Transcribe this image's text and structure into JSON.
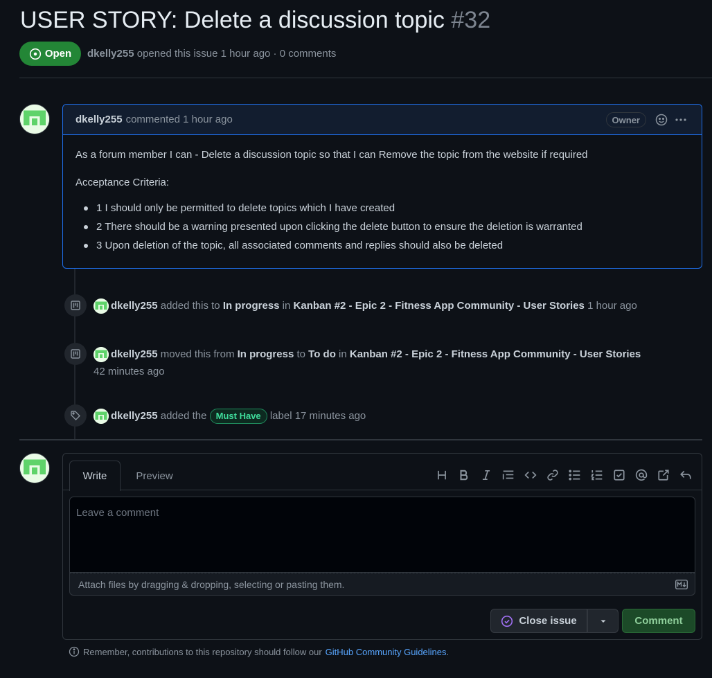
{
  "issue": {
    "title": "USER STORY: Delete a discussion topic",
    "number": "#32",
    "state": "Open",
    "author": "dkelly255",
    "meta_rest": "opened this issue 1 hour ago · 0 comments"
  },
  "comment": {
    "author": "dkelly255",
    "action": "commented 1 hour ago",
    "badge": "Owner",
    "paragraph": "As a forum member I can - Delete a discussion topic so that I can Remove the topic from the website if required",
    "criteria_heading": "Acceptance Criteria:",
    "criteria": [
      "1 I should only be permitted to delete topics which I have created",
      "2 There should be a warning presented upon clicking the delete button to ensure the deletion is warranted",
      "3 Upon deletion of the topic, all associated comments and replies should also be deleted"
    ]
  },
  "timeline": [
    {
      "icon": "project-icon",
      "actor": "dkelly255",
      "text1": "added this to",
      "column": "In progress",
      "text2": "in",
      "project": "Kanban #2 - Epic 2 - Fitness App Community - User Stories",
      "time": "1 hour ago"
    },
    {
      "icon": "project-icon",
      "actor": "dkelly255",
      "text1": "moved this from",
      "from_column": "In progress",
      "text_to": "to",
      "to_column": "To do",
      "text2": "in",
      "project": "Kanban #2 - Epic 2 - Fitness App Community - User Stories",
      "time": "42 minutes ago"
    },
    {
      "icon": "tag-icon",
      "actor": "dkelly255",
      "text1": "added the",
      "label": "Must Have",
      "text2": "label 17 minutes ago"
    }
  ],
  "editor": {
    "tab_write": "Write",
    "tab_preview": "Preview",
    "placeholder": "Leave a comment",
    "attach_text": "Attach files by dragging & dropping, selecting or pasting them.",
    "close_issue": "Close issue",
    "comment_button": "Comment",
    "toolbar_icons": [
      "heading-icon",
      "bold-icon",
      "italic-icon",
      "quote-icon",
      "code-icon",
      "link-icon",
      "bullet-list-icon",
      "numbered-list-icon",
      "tasklist-icon",
      "mention-icon",
      "reference-icon",
      "reply-icon"
    ]
  },
  "footer": {
    "text": "Remember, contributions to this repository should follow our",
    "link": "GitHub Community Guidelines",
    "end": "."
  },
  "colors": {
    "background": "#0d1117",
    "open_green": "#238636",
    "link_blue": "#58a6ff",
    "label_green": "#3fdc9b",
    "highlight_border": "#1f6feb"
  }
}
